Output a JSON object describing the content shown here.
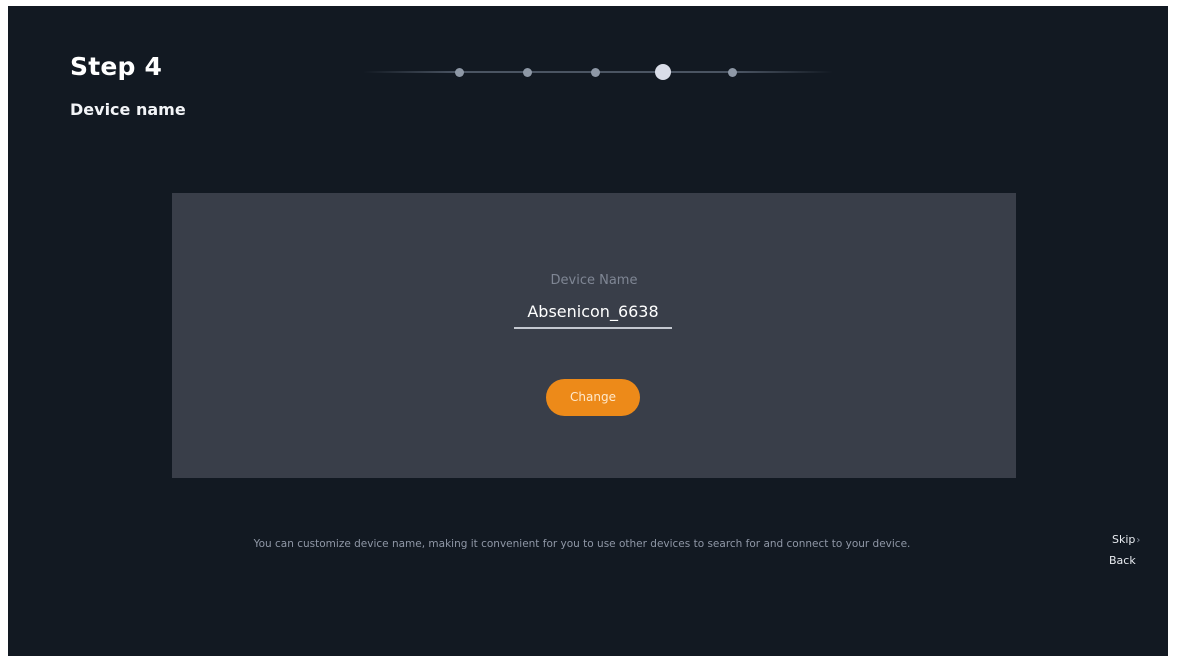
{
  "header": {
    "step_title": "Step 4",
    "step_subtitle": "Device name"
  },
  "progress": {
    "total_steps": 5,
    "current_step": 4
  },
  "card": {
    "field_label": "Device Name",
    "field_value": "Absenicon_6638",
    "change_label": "Change"
  },
  "footer": {
    "hint": "You can customize device name, making it convenient for you to use other devices to search for and connect to your device.",
    "skip_label": "Skip",
    "back_label": "Back"
  },
  "icons": {
    "skip_chevron": "chevron-right-icon"
  },
  "colors": {
    "background": "#121922",
    "card": "#393e49",
    "accent": "#ed8a19",
    "active_dot": "#d9dde8",
    "inactive_dot": "#8e98a6"
  }
}
